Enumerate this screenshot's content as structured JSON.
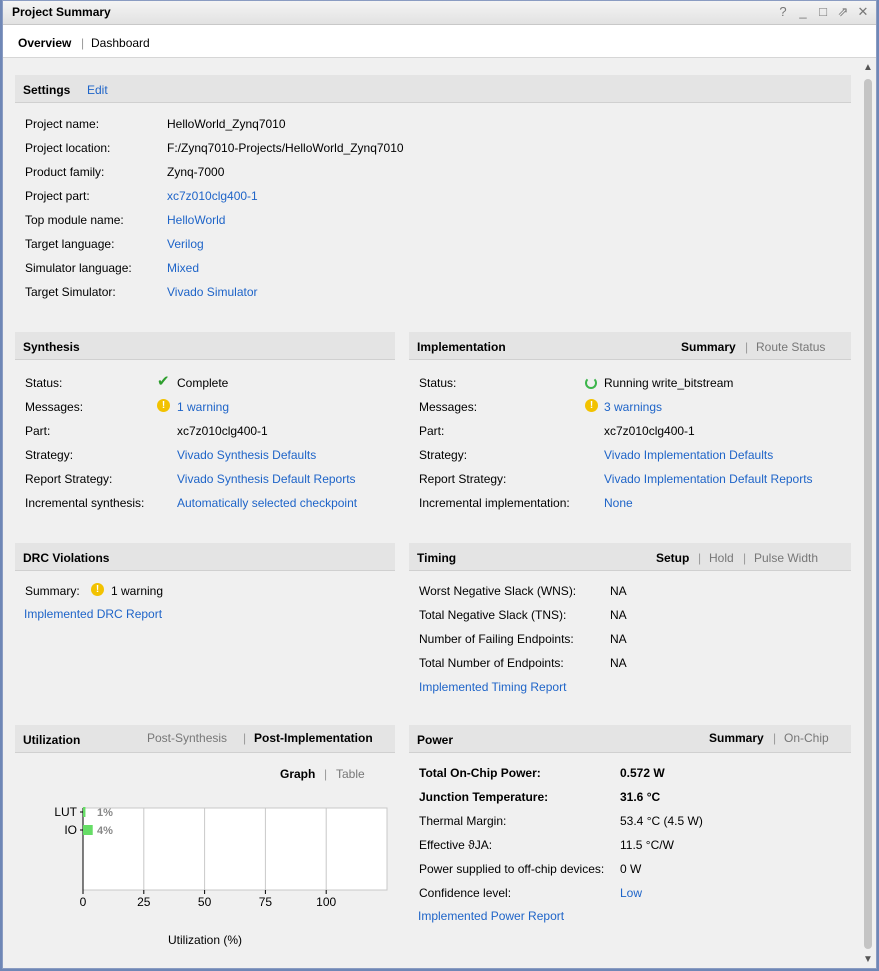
{
  "window": {
    "title": "Project Summary",
    "icons": [
      "help-icon",
      "minimize-icon",
      "restore-icon",
      "float-icon",
      "close-icon"
    ]
  },
  "tabs": {
    "overview": "Overview",
    "separator": "|",
    "dashboard": "Dashboard"
  },
  "settings": {
    "title": "Settings",
    "edit": "Edit",
    "rows": [
      {
        "label": "Project name:",
        "value": "HelloWorld_Zynq7010",
        "link": false
      },
      {
        "label": "Project location:",
        "value": "F:/Zynq7010-Projects/HelloWorld_Zynq7010",
        "link": false
      },
      {
        "label": "Product family:",
        "value": "Zynq-7000",
        "link": false
      },
      {
        "label": "Project part:",
        "value": "xc7z010clg400-1",
        "link": true
      },
      {
        "label": "Top module name:",
        "value": "HelloWorld",
        "link": true
      },
      {
        "label": "Target language:",
        "value": "Verilog",
        "link": true
      },
      {
        "label": "Simulator language:",
        "value": "Mixed",
        "link": true
      },
      {
        "label": "Target Simulator:",
        "value": "Vivado Simulator",
        "link": true
      }
    ]
  },
  "synthesis": {
    "title": "Synthesis",
    "rows": [
      {
        "label": "Status:",
        "value": "Complete"
      },
      {
        "label": "Messages:",
        "value": "1 warning"
      },
      {
        "label": "Part:",
        "value": "xc7z010clg400-1"
      },
      {
        "label": "Strategy:",
        "value": "Vivado Synthesis Defaults"
      },
      {
        "label": "Report Strategy:",
        "value": "Vivado Synthesis Default Reports"
      },
      {
        "label": "Incremental synthesis:",
        "value": "Automatically selected checkpoint"
      }
    ]
  },
  "implementation": {
    "title": "Implementation",
    "tab_summary": "Summary",
    "tab_sep": "|",
    "tab_route": "Route Status",
    "rows": [
      {
        "label": "Status:",
        "value": "Running write_bitstream"
      },
      {
        "label": "Messages:",
        "value": "3 warnings"
      },
      {
        "label": "Part:",
        "value": "xc7z010clg400-1"
      },
      {
        "label": "Strategy:",
        "value": "Vivado Implementation Defaults"
      },
      {
        "label": "Report Strategy:",
        "value": "Vivado Implementation Default Reports"
      },
      {
        "label": "Incremental implementation:",
        "value": "None"
      }
    ]
  },
  "drc": {
    "title": "DRC Violations",
    "summary_label": "Summary:",
    "summary_value": "1 warning",
    "report_link": "Implemented DRC Report"
  },
  "timing": {
    "title": "Timing",
    "tab_setup": "Setup",
    "tab_hold": "Hold",
    "tab_pulse": "Pulse Width",
    "sep": "|",
    "rows": [
      {
        "label": "Worst Negative Slack (WNS):",
        "value": "NA"
      },
      {
        "label": "Total Negative Slack (TNS):",
        "value": "NA"
      },
      {
        "label": "Number of Failing Endpoints:",
        "value": "NA"
      },
      {
        "label": "Total Number of Endpoints:",
        "value": "NA"
      }
    ],
    "report_link": "Implemented Timing Report"
  },
  "utilization": {
    "title": "Utilization",
    "tab_post_synth": "Post-Synthesis",
    "tab_post_impl": "Post-Implementation",
    "sep": "|",
    "view_graph": "Graph",
    "view_table": "Table"
  },
  "power": {
    "title": "Power",
    "tab_summary": "Summary",
    "tab_onchip": "On-Chip",
    "sep": "|",
    "rows": [
      {
        "label": "Total On-Chip Power:",
        "value": "0.572 W",
        "bold": true,
        "link": false
      },
      {
        "label": "Junction Temperature:",
        "value": "31.6 °C",
        "bold": true,
        "link": false
      },
      {
        "label": "Thermal Margin:",
        "value": "53.4 °C (4.5 W)",
        "bold": false,
        "link": false
      },
      {
        "label": "Effective ϑJA:",
        "value": "11.5 °C/W",
        "bold": false,
        "link": false
      },
      {
        "label": "Power supplied to off-chip devices:",
        "value": "0 W",
        "bold": false,
        "link": false
      },
      {
        "label": "Confidence level:",
        "value": "Low",
        "bold": false,
        "link": true
      }
    ],
    "report_link": "Implemented Power Report"
  },
  "colors": {
    "link": "#1e64c8",
    "header_bg": "#e4e4e4",
    "bar_green": "#66dd66",
    "check_green": "#2e9e2e",
    "warning_yellow": "#f2c200"
  },
  "chart_data": {
    "type": "bar",
    "orientation": "horizontal",
    "categories": [
      "LUT",
      "IO"
    ],
    "values": [
      1,
      4
    ],
    "value_labels": [
      "1%",
      "4%"
    ],
    "xlabel": "Utilization (%)",
    "xticks": [
      "0",
      "25",
      "50",
      "75",
      "100"
    ],
    "xlim": [
      0,
      125
    ],
    "grid": true
  }
}
